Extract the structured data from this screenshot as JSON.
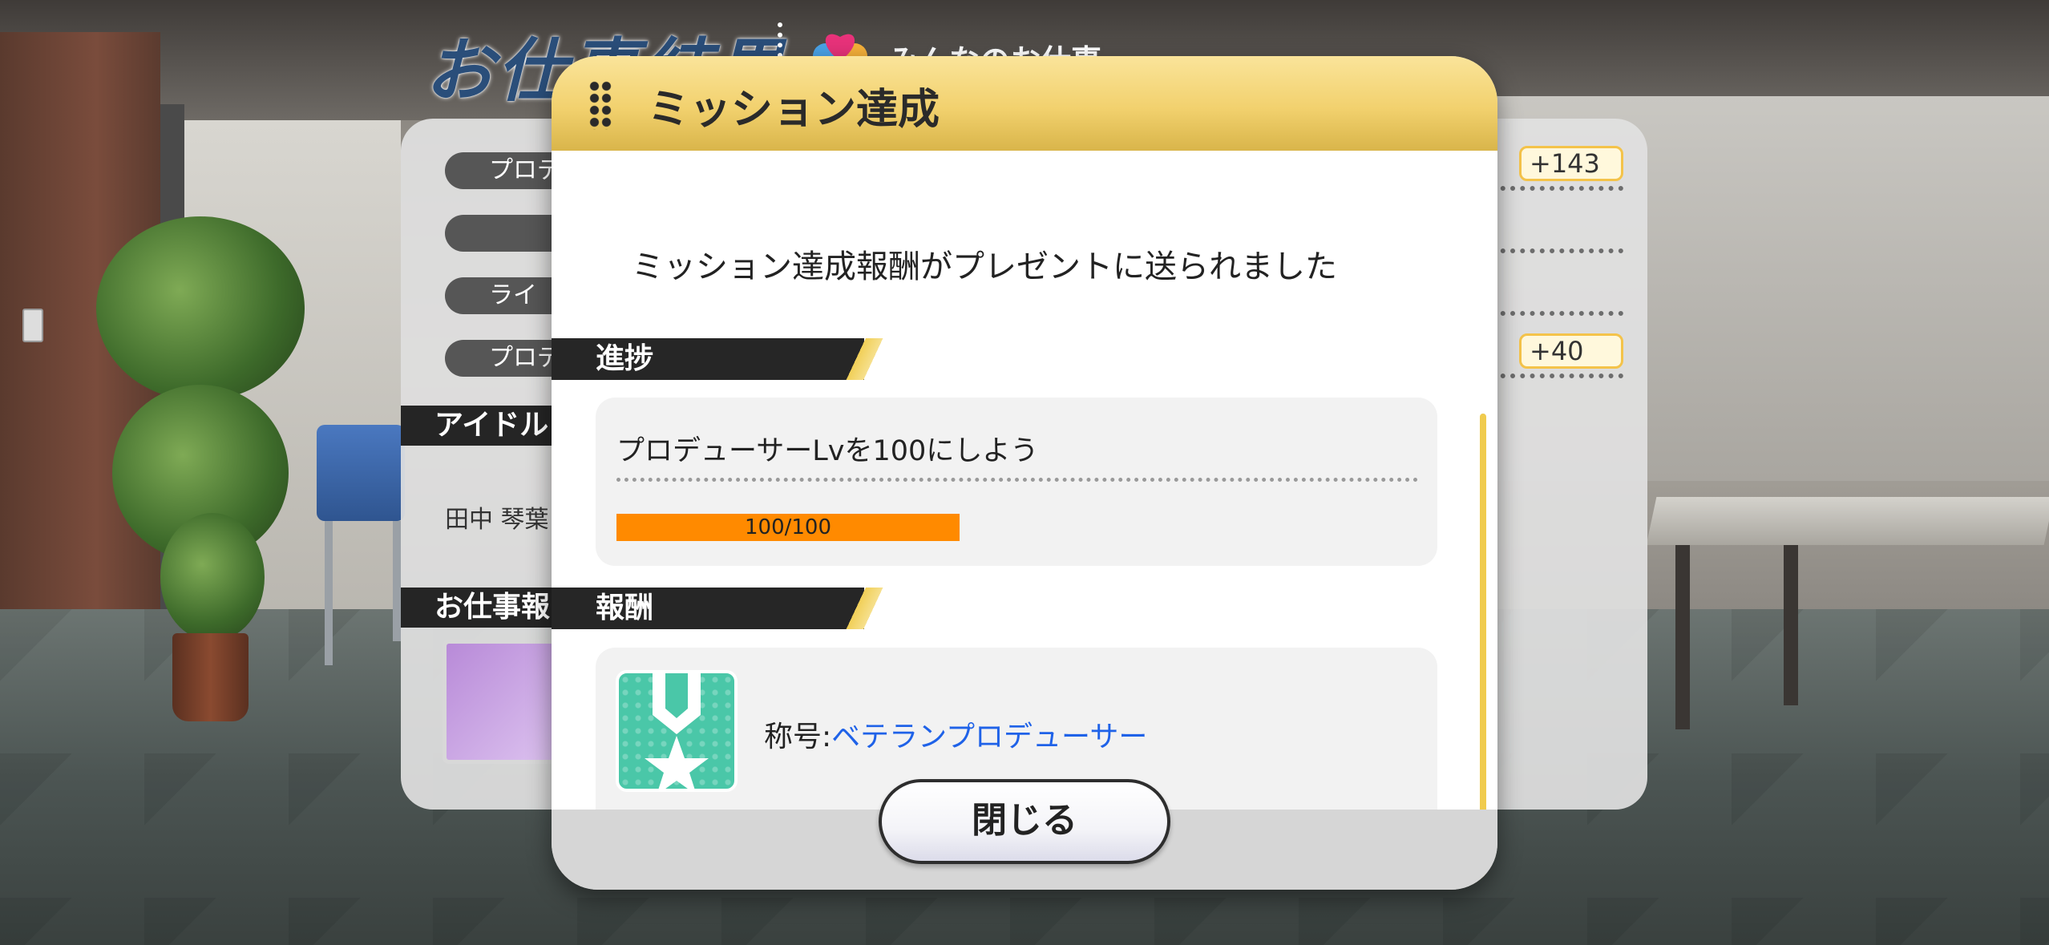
{
  "background": {
    "screen_title": "お仕事結果",
    "mode_label": "みんなのお仕事",
    "stats": [
      {
        "label": "プロデ",
        "value": "+143"
      },
      {
        "label": "",
        "value": ""
      },
      {
        "label": "ライ",
        "value": ""
      },
      {
        "label": "プロデュ",
        "value": "+40"
      }
    ],
    "idol_section": "アイドル",
    "idol_name": "田中 琴葉",
    "reward_section": "お仕事報"
  },
  "modal": {
    "title": "ミッション達成",
    "message": "ミッション達成報酬がプレゼントに送られました",
    "progress_section": "進捗",
    "mission_text": "プロデューサーLvを100にしよう",
    "progress": {
      "current": 100,
      "max": 100,
      "text": "100/100"
    },
    "reward_section": "報酬",
    "reward_prefix": "称号:",
    "reward_name": "ベテランプロデューサー",
    "close_label": "閉じる"
  },
  "colors": {
    "accent_gold": "#f2d16e",
    "progress_orange": "#ff8a00",
    "link_blue": "#1f62e8",
    "reward_icon_teal": "#4ac7a8"
  },
  "icons": {
    "grip": "grip-dots-icon",
    "reward": "medal-star-icon",
    "mode": "heart-icon"
  }
}
